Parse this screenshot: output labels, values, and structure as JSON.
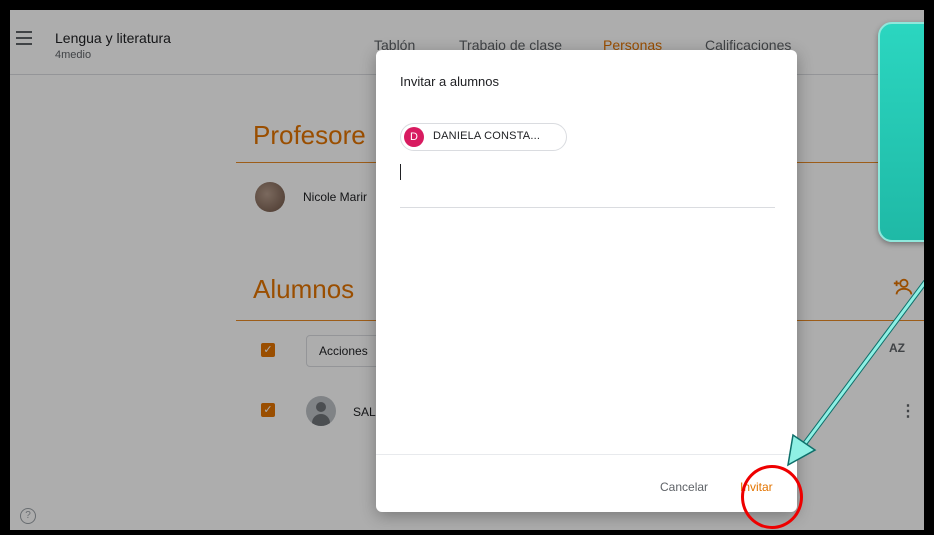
{
  "header": {
    "class_title": "Lengua y literatura",
    "class_section": "4medio",
    "tabs": [
      {
        "label": "Tablón",
        "active": false
      },
      {
        "label": "Trabajo de clase",
        "active": false
      },
      {
        "label": "Personas",
        "active": true
      },
      {
        "label": "Calificaciones",
        "active": false
      }
    ]
  },
  "page": {
    "teachers_title": "Profesore",
    "teacher_name": "Nicole Marir",
    "students_title": "Alumnos",
    "actions_label": "Acciones",
    "sort_label": "AZ",
    "student_name": "SAL",
    "help_glyph": "?",
    "more_glyph": "⋮"
  },
  "dialog": {
    "title": "Invitar a alumnos",
    "chip_initial": "D",
    "chip_label": "DANIELA CONSTA...",
    "cancel_label": "Cancelar",
    "invite_label": "Invitar"
  },
  "colors": {
    "accent": "#e37400",
    "chip_avatar": "#d81b60",
    "callout": "#2bd6c0",
    "highlight": "#ee0000"
  }
}
